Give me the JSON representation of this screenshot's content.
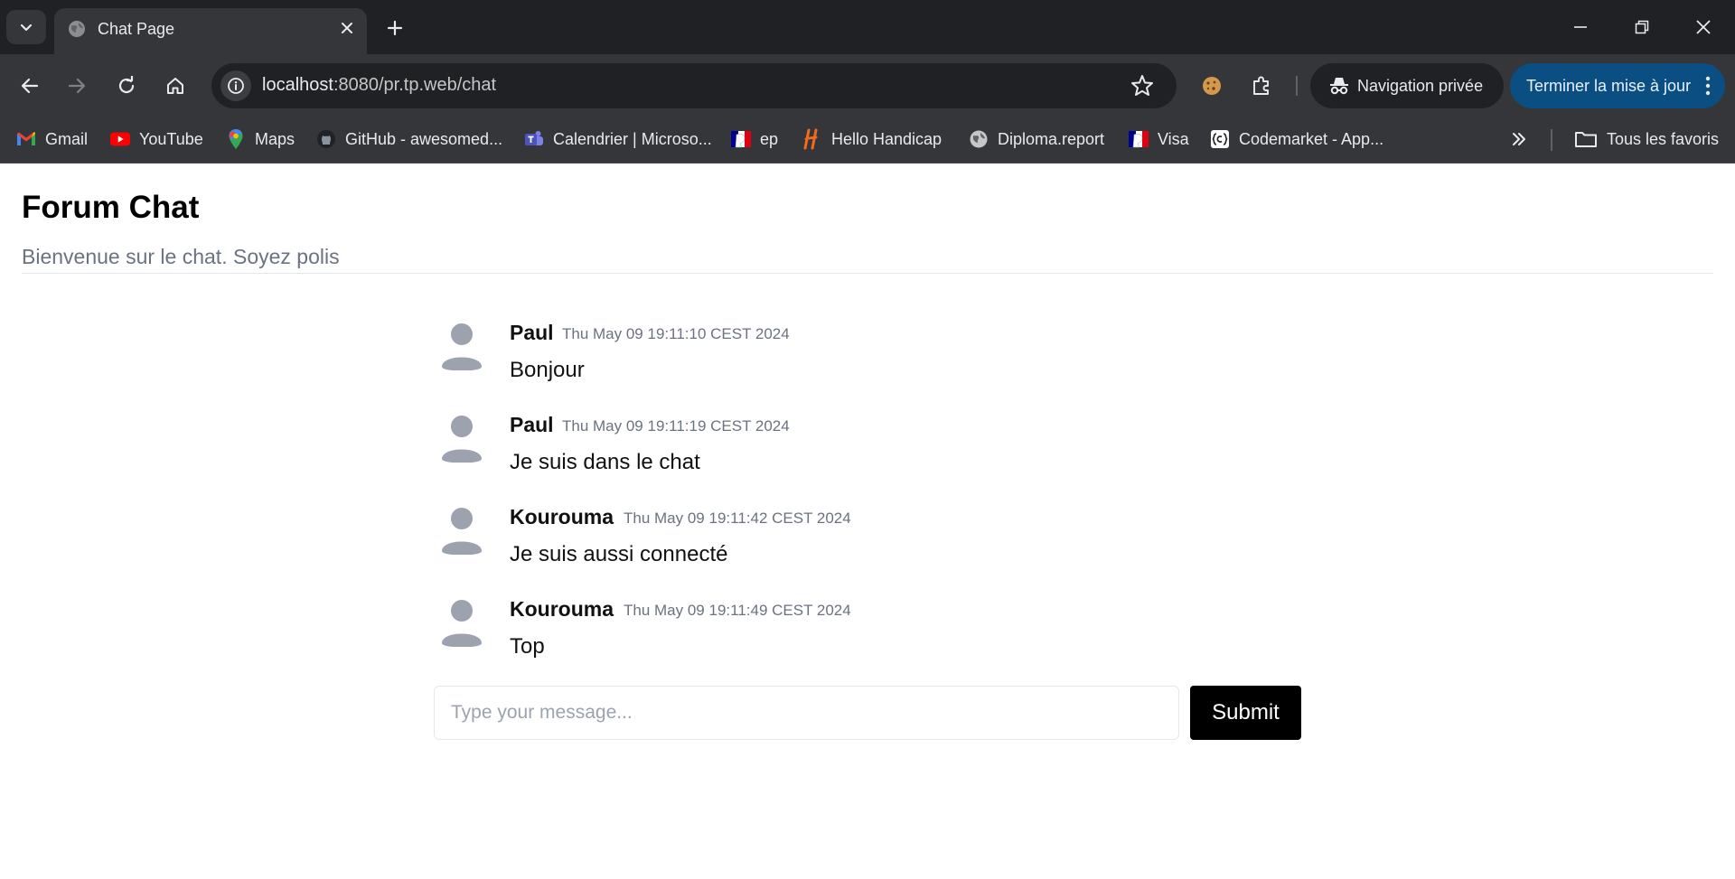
{
  "browser": {
    "tab_title": "Chat Page",
    "url_host": "localhost",
    "url_rest": ":8080/pr.tp.web/chat",
    "incognito_label": "Navigation privée",
    "update_label": "Terminer la mise à jour",
    "accent_color": "#0b4f82"
  },
  "bookmarks": {
    "items": [
      {
        "label": "Gmail",
        "icon": "gmail-icon"
      },
      {
        "label": "YouTube",
        "icon": "youtube-icon"
      },
      {
        "label": "Maps",
        "icon": "maps-icon"
      },
      {
        "label": "GitHub - awesomed...",
        "icon": "github-icon"
      },
      {
        "label": "Calendrier | Microso...",
        "icon": "teams-icon"
      },
      {
        "label": "ep",
        "icon": "marianne-icon"
      },
      {
        "label": "Hello Handicap",
        "icon": "hello-handicap-icon"
      },
      {
        "label": "Diploma.report",
        "icon": "globe-icon"
      },
      {
        "label": "Visa",
        "icon": "marianne-icon"
      },
      {
        "label": "Codemarket - App...",
        "icon": "codemarket-icon"
      }
    ],
    "all_bookmarks_label": "Tous les favoris"
  },
  "page": {
    "title": "Forum Chat",
    "subtitle": "Bienvenue sur le chat. Soyez polis"
  },
  "messages": [
    {
      "author": "Paul",
      "time": "Thu May 09 19:11:10 CEST 2024",
      "text": "Bonjour"
    },
    {
      "author": "Paul",
      "time": "Thu May 09 19:11:19 CEST 2024",
      "text": "Je suis dans le chat"
    },
    {
      "author": "Kourouma",
      "time": "Thu May 09 19:11:42 CEST 2024",
      "text": "Je suis aussi connecté"
    },
    {
      "author": "Kourouma",
      "time": "Thu May 09 19:11:49 CEST 2024",
      "text": "Top"
    }
  ],
  "composer": {
    "placeholder": "Type your message...",
    "value": "",
    "submit_label": "Submit"
  }
}
